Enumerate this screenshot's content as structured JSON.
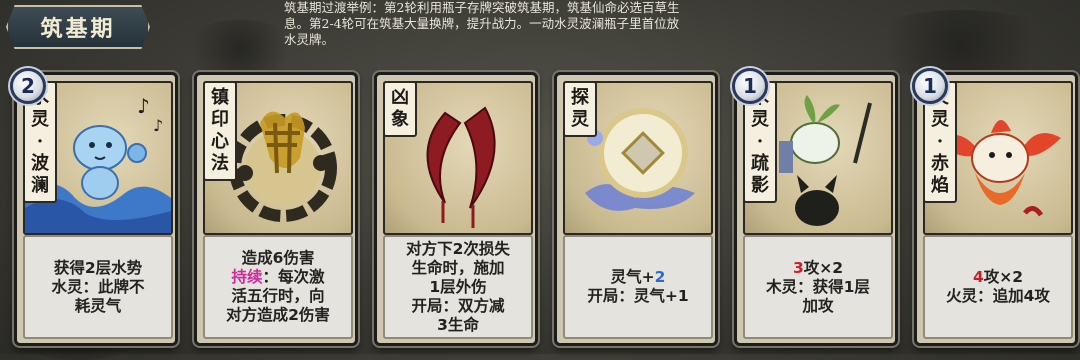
{
  "header": {
    "title": "筑基期",
    "description_lines": [
      "筑基期过渡举例：第2轮利用瓶子存牌突破筑基期，筑基仙命必选百草生",
      "息。第2-4轮可在筑基大量换牌，提升战力。一动水灵波澜瓶子里首位放",
      "水灵牌。"
    ]
  },
  "colors": {
    "keyword_pink": "#cc2b9c",
    "number_red": "#c8202b",
    "number_blue": "#2c6ad6"
  },
  "cards": [
    {
      "cost": "2",
      "name_chars": [
        "水",
        "灵",
        "·",
        "波",
        "澜"
      ],
      "art_icon": "water-spirit-art",
      "text": {
        "l1": "获得2层水势",
        "l2": "水灵：此牌不",
        "l3": "耗灵气"
      }
    },
    {
      "cost": "",
      "name_chars": [
        "镇",
        "印",
        "心",
        "法"
      ],
      "art_icon": "seal-talisman-art",
      "text": {
        "l1": "造成6伤害",
        "l2_kw": "持续",
        "l2_rest": "：每次激",
        "l3": "活五行时，向",
        "l4": "对方造成2伤害"
      }
    },
    {
      "cost": "",
      "name_chars": [
        "凶",
        "象"
      ],
      "art_icon": "fang-art",
      "text": {
        "l1": "对方下2次损失",
        "l2": "生命时，施加",
        "l3": "1层外伤",
        "l4": "开局：双方减",
        "l5": "3生命"
      }
    },
    {
      "cost": "",
      "name_chars": [
        "探",
        "灵"
      ],
      "art_icon": "coin-cloud-art",
      "text": {
        "l1_pre": "灵气+",
        "l1_num": "2",
        "l2": "开局：灵气+1"
      }
    },
    {
      "cost": "1",
      "name_chars": [
        "木",
        "灵",
        "·",
        "疏",
        "影"
      ],
      "art_icon": "wood-spirit-art",
      "text": {
        "l1_num": "3",
        "l1_rest": "攻×2",
        "l2": "木灵：获得1层",
        "l3": "加攻"
      }
    },
    {
      "cost": "1",
      "name_chars": [
        "火",
        "灵",
        "·",
        "赤",
        "焰"
      ],
      "art_icon": "fire-spirit-art",
      "text": {
        "l1_num": "4",
        "l1_rest": "攻×2",
        "l2": "火灵：追加4攻"
      }
    }
  ]
}
